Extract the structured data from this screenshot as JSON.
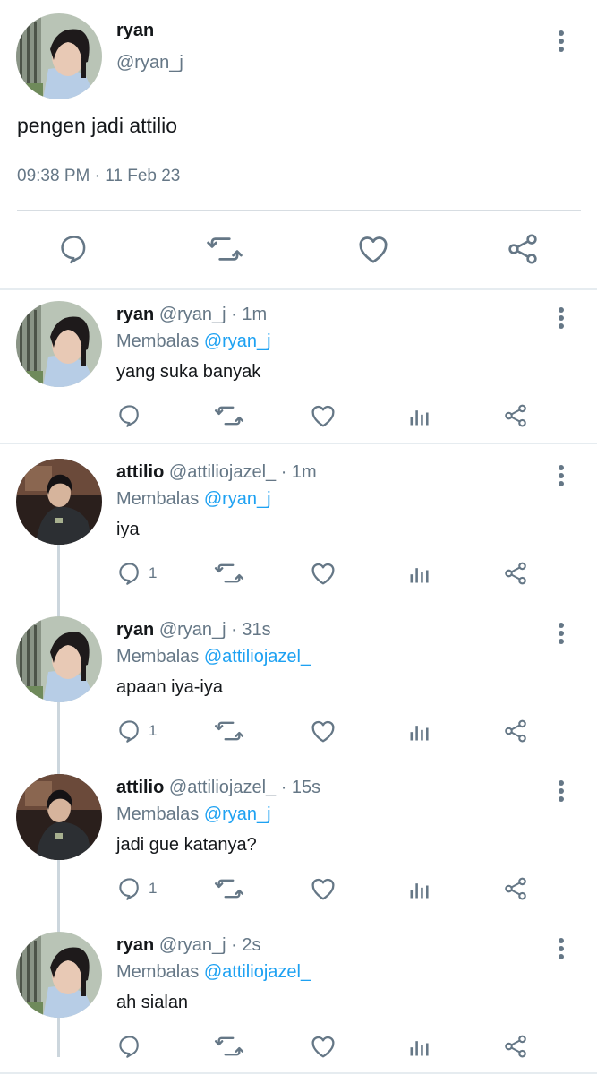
{
  "main_tweet": {
    "name": "ryan",
    "handle": "@ryan_j",
    "text": "pengen jadi attilio",
    "timestamp": "09:38 PM · 11 Feb 23",
    "actions": [
      "reply-icon",
      "retweet-icon",
      "like-icon",
      "share-icon"
    ]
  },
  "replies": [
    {
      "name": "ryan",
      "meta": "@ryan_j · 1m",
      "reply_label": "Membalas",
      "reply_to": "@ryan_j",
      "text": "yang suka banyak",
      "reply_count": "",
      "avatar": "ryan"
    },
    {
      "name": "attilio",
      "meta": "@attiliojazel_ · 1m",
      "reply_label": "Membalas",
      "reply_to": "@ryan_j",
      "text": "iya",
      "reply_count": "1",
      "avatar": "attilio"
    },
    {
      "name": "ryan",
      "meta": "@ryan_j · 31s",
      "reply_label": "Membalas",
      "reply_to": "@attiliojazel_",
      "text": "apaan iya-iya",
      "reply_count": "1",
      "avatar": "ryan"
    },
    {
      "name": "attilio",
      "meta": "@attiliojazel_ · 15s",
      "reply_label": "Membalas",
      "reply_to": "@ryan_j",
      "text": "jadi gue katanya?",
      "reply_count": "1",
      "avatar": "attilio"
    },
    {
      "name": "ryan",
      "meta": "@ryan_j · 2s",
      "reply_label": "Membalas",
      "reply_to": "@attiliojazel_",
      "text": "ah sialan",
      "reply_count": "",
      "avatar": "ryan"
    }
  ],
  "colors": {
    "text": "#14171a",
    "secondary": "#657786",
    "mention": "#1da1f2",
    "divider": "#e6ecf0"
  }
}
